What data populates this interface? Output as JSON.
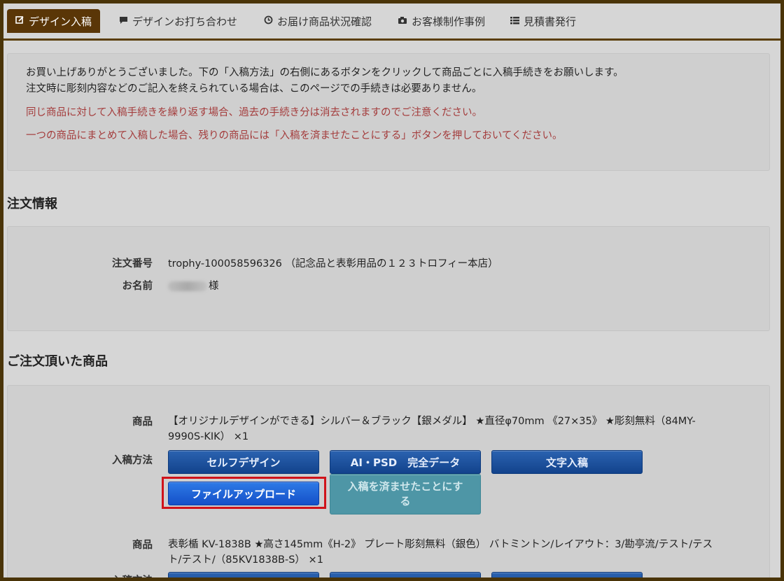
{
  "tabs": [
    {
      "label": "デザイン入稿",
      "icon": "edit-icon",
      "active": true
    },
    {
      "label": "デザインお打ち合わせ",
      "icon": "comment-icon",
      "active": false
    },
    {
      "label": "お届け商品状況確認",
      "icon": "clock-icon",
      "active": false
    },
    {
      "label": "お客様制作事例",
      "icon": "camera-icon",
      "active": false
    },
    {
      "label": "見積書発行",
      "icon": "list-icon",
      "active": false
    }
  ],
  "notice": {
    "line1": "お買い上げありがとうございました。下の「入稿方法」の右側にあるボタンをクリックして商品ごとに入稿手続きをお願いします。",
    "line2": "注文時に彫刻内容などのご記入を終えられている場合は、このページでの手続きは必要ありません。",
    "warn1": "同じ商品に対して入稿手続きを繰り返す場合、過去の手続き分は消去されますのでご注意ください。",
    "warn2": "一つの商品にまとめて入稿した場合、残りの商品には「入稿を済ませたことにする」ボタンを押しておいてください。"
  },
  "order": {
    "title": "注文情報",
    "number_label": "注文番号",
    "number_value": "trophy-100058596326 （記念品と表彰用品の１２３トロフィー本店）",
    "name_label": "お名前",
    "name_suffix": "様"
  },
  "products": {
    "title": "ご注文頂いた商品",
    "product_label": "商品",
    "method_label": "入稿方法",
    "items": [
      {
        "name_line1": "【オリジナルデザインができる】シルバー＆ブラック【銀メダル】 ★直径φ70mm 《27×35》 ★彫刻無料（84MY-",
        "name_line2": "9990S-KIK） ×1"
      },
      {
        "name_line1": "表彰楯 KV-1838B ★高さ145mm《H-2》 プレート彫刻無料（銀色） バトミントン/レイアウト：3/勘亭流/テスト/テス",
        "name_line2": "ト/テスト/（85KV1838B-S） ×1"
      }
    ],
    "buttons": {
      "self_design": "セルフデザイン",
      "ai_psd": "AI・PSD　完全データ",
      "text_input": "文字入稿",
      "file_upload": "ファイルアップロード",
      "mark_done_line1": "入稿を済ませたことにす",
      "mark_done_line2": "る"
    }
  },
  "colors": {
    "brand": "#5a3607",
    "warning_text": "#a43c3c",
    "button_blue": "#1a4c96",
    "highlight": "#d0131a"
  }
}
